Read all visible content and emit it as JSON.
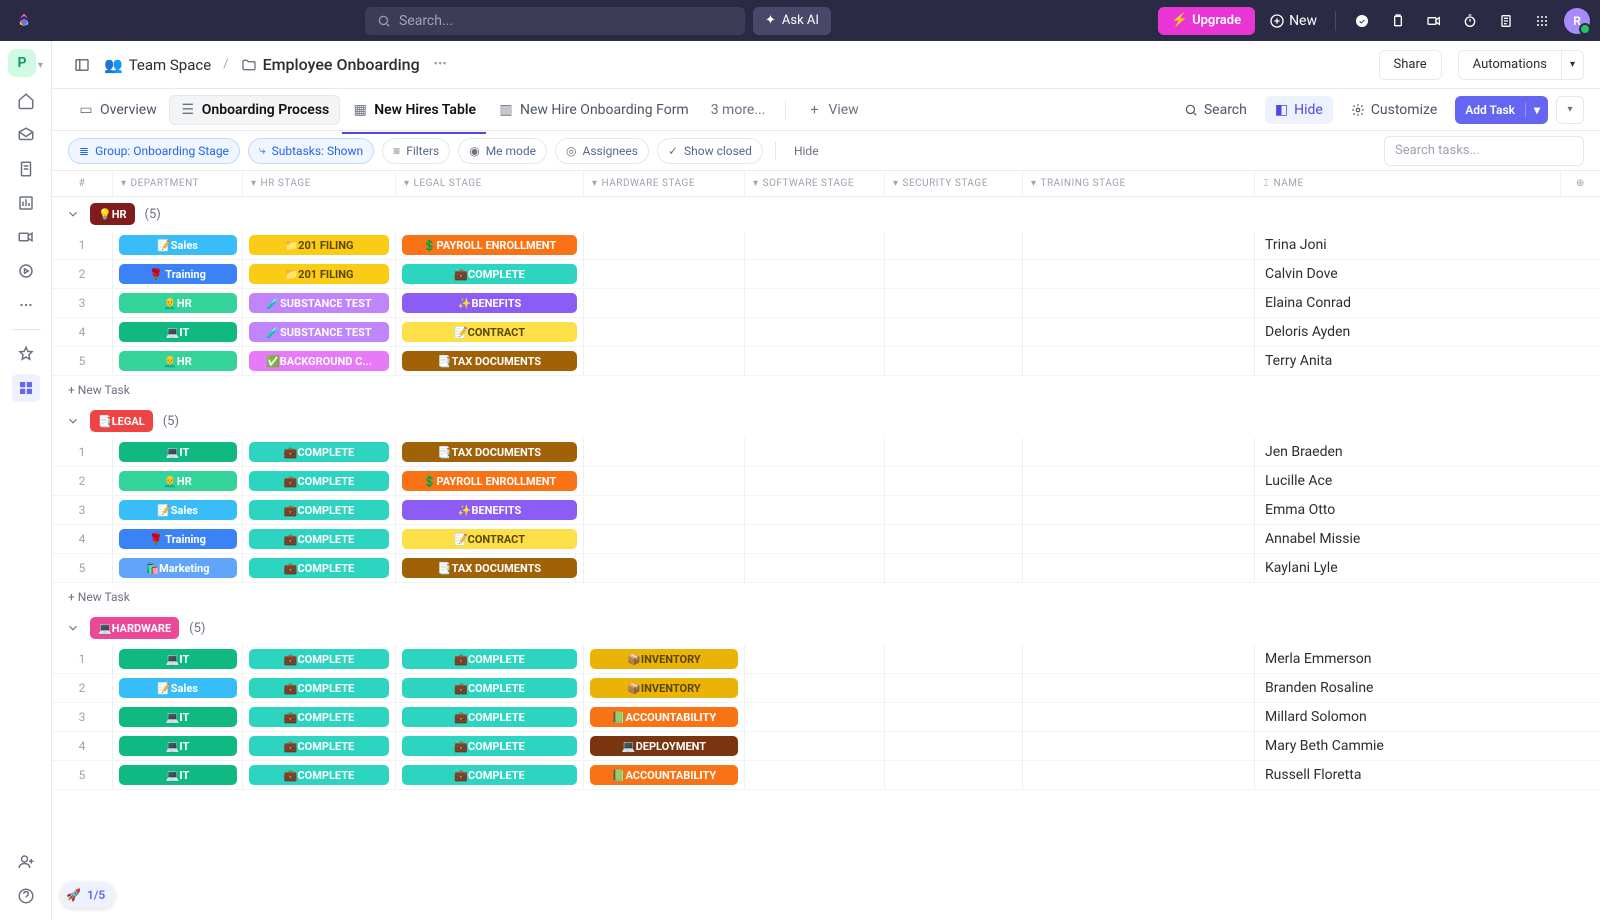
{
  "topbar": {
    "search_placeholder": "Search...",
    "ask_ai": "Ask AI",
    "upgrade": "Upgrade",
    "new": "New",
    "avatar_letter": "R"
  },
  "header": {
    "workspace_letter": "P",
    "space": "Team Space",
    "folder": "Employee Onboarding",
    "share": "Share",
    "automations": "Automations"
  },
  "tabs": {
    "overview": "Overview",
    "process": "Onboarding Process",
    "hires": "New Hires Table",
    "form": "New Hire Onboarding Form",
    "more": "3 more...",
    "view": "View",
    "search": "Search",
    "hide": "Hide",
    "customize": "Customize",
    "add_task": "Add Task"
  },
  "filters": {
    "group": "Group: Onboarding Stage",
    "subtasks": "Subtasks: Shown",
    "filters": "Filters",
    "me": "Me mode",
    "assignees": "Assignees",
    "closed": "Show closed",
    "hide": "Hide",
    "search_placeholder": "Search tasks..."
  },
  "columns": {
    "num": "#",
    "dept": "DEPARTMENT",
    "hr": "HR STAGE",
    "legal": "LEGAL STAGE",
    "hw": "HARDWARE STAGE",
    "sw": "SOFTWARE STAGE",
    "sec": "SECURITY STAGE",
    "tr": "TRAINING STAGE",
    "name": "NAME"
  },
  "pill_labels": {
    "sales": "📝Sales",
    "training": "🌹 Training",
    "hr": "👨‍🦲HR",
    "it": "💻IT",
    "marketing": "🛍️Marketing",
    "filing201": "📁201 FILING",
    "substance": "🧪SUBSTANCE TEST",
    "background": "✅BACKGROUND C...",
    "complete": "💼COMPLETE",
    "payroll": "💲PAYROLL ENROLLMENT",
    "benefits": "✨BENEFITS",
    "contract": "📝CONTRACT",
    "tax": "📑TAX DOCUMENTS",
    "inventory": "📦INVENTORY",
    "accountability": "📗ACCOUNTABILITY",
    "deployment": "💻DEPLOYMENT"
  },
  "groups": [
    {
      "badge": "💡HR",
      "badge_class": "gb-hr",
      "count": "(5)",
      "rows": [
        {
          "num": "1",
          "dept": "sales",
          "hr": "filing201",
          "legal": "payroll",
          "hw": "",
          "name": "Trina Joni"
        },
        {
          "num": "2",
          "dept": "training",
          "hr": "filing201",
          "legal": "complete",
          "hw": "",
          "name": "Calvin Dove"
        },
        {
          "num": "3",
          "dept": "hr",
          "hr": "substance",
          "legal": "benefits",
          "hw": "",
          "name": "Elaina Conrad"
        },
        {
          "num": "4",
          "dept": "it",
          "hr": "substance",
          "legal": "contract",
          "hw": "",
          "name": "Deloris Ayden"
        },
        {
          "num": "5",
          "dept": "hr",
          "hr": "background",
          "legal": "tax",
          "hw": "",
          "name": "Terry Anita"
        }
      ]
    },
    {
      "badge": "📑LEGAL",
      "badge_class": "gb-legal",
      "count": "(5)",
      "rows": [
        {
          "num": "1",
          "dept": "it",
          "hr": "complete",
          "legal": "tax",
          "hw": "",
          "name": "Jen Braeden"
        },
        {
          "num": "2",
          "dept": "hr",
          "hr": "complete",
          "legal": "payroll",
          "hw": "",
          "name": "Lucille Ace"
        },
        {
          "num": "3",
          "dept": "sales",
          "hr": "complete",
          "legal": "benefits",
          "hw": "",
          "name": "Emma Otto"
        },
        {
          "num": "4",
          "dept": "training",
          "hr": "complete",
          "legal": "contract",
          "hw": "",
          "name": "Annabel Missie"
        },
        {
          "num": "5",
          "dept": "marketing",
          "hr": "complete",
          "legal": "tax",
          "hw": "",
          "name": "Kaylani Lyle"
        }
      ]
    },
    {
      "badge": "💻HARDWARE",
      "badge_class": "gb-hw",
      "count": "(5)",
      "rows": [
        {
          "num": "1",
          "dept": "it",
          "hr": "complete",
          "legal": "complete",
          "hw": "inventory",
          "name": "Merla Emmerson"
        },
        {
          "num": "2",
          "dept": "sales",
          "hr": "complete",
          "legal": "complete",
          "hw": "inventory",
          "name": "Branden Rosaline"
        },
        {
          "num": "3",
          "dept": "it",
          "hr": "complete",
          "legal": "complete",
          "hw": "accountability",
          "name": "Millard Solomon"
        },
        {
          "num": "4",
          "dept": "it",
          "hr": "complete",
          "legal": "complete",
          "hw": "deployment",
          "name": "Mary Beth Cammie"
        },
        {
          "num": "5",
          "dept": "it",
          "hr": "complete",
          "legal": "complete",
          "hw": "accountability",
          "name": "Russell Floretta"
        }
      ]
    }
  ],
  "new_task": "+ New Task",
  "progress": "1/5"
}
